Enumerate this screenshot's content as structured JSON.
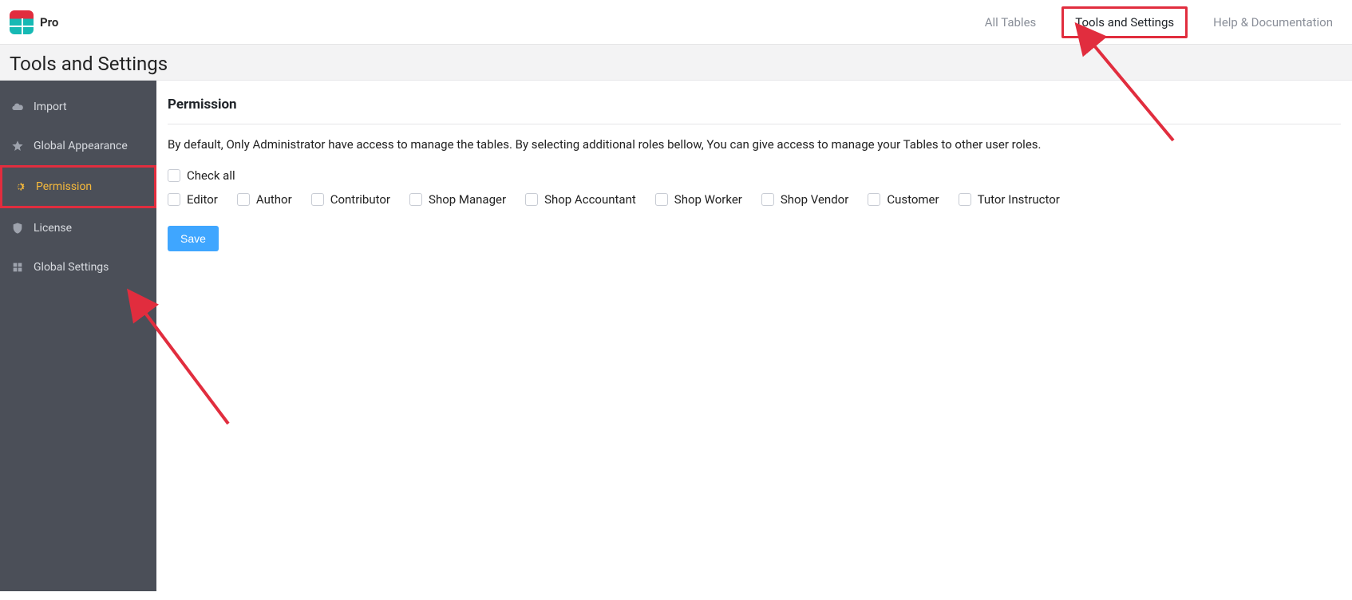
{
  "brand": {
    "title": "Pro"
  },
  "topnav": {
    "items": [
      {
        "label": "All Tables"
      },
      {
        "label": "Tools and Settings"
      },
      {
        "label": "Help & Documentation"
      }
    ]
  },
  "subhead": {
    "title": "Tools and Settings"
  },
  "sidebar": {
    "items": [
      {
        "label": "Import"
      },
      {
        "label": "Global Appearance"
      },
      {
        "label": "Permission"
      },
      {
        "label": "License"
      },
      {
        "label": "Global Settings"
      }
    ]
  },
  "main": {
    "section_title": "Permission",
    "description": "By default, Only Administrator have access to manage the tables. By selecting additional roles bellow, You can give access to manage your Tables to other user roles.",
    "check_all_label": "Check all",
    "roles": [
      {
        "label": "Editor"
      },
      {
        "label": "Author"
      },
      {
        "label": "Contributor"
      },
      {
        "label": "Shop Manager"
      },
      {
        "label": "Shop Accountant"
      },
      {
        "label": "Shop Worker"
      },
      {
        "label": "Shop Vendor"
      },
      {
        "label": "Customer"
      },
      {
        "label": "Tutor Instructor"
      }
    ],
    "save_label": "Save"
  }
}
